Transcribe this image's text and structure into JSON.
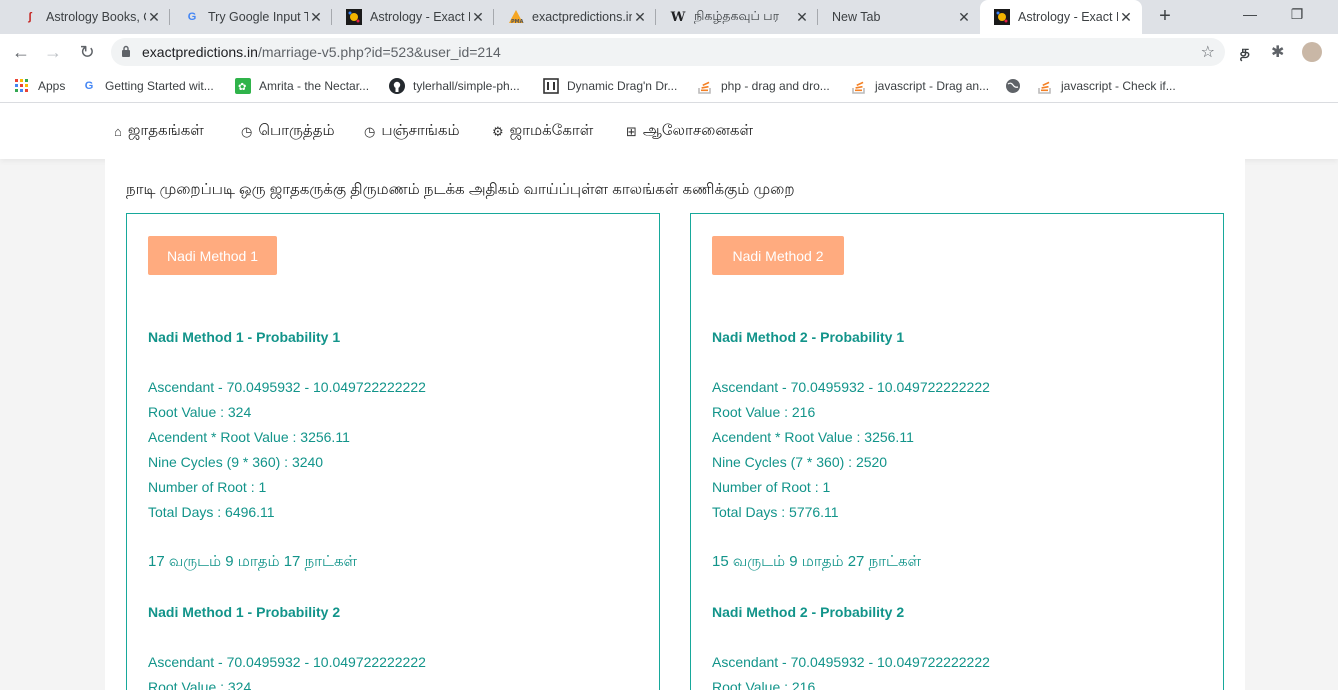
{
  "browser": {
    "tabs": [
      {
        "title": "Astrology Books, C",
        "icon": "pdf-red-icon",
        "active": false
      },
      {
        "title": "Try Google Input T",
        "icon": "google-icon",
        "active": false
      },
      {
        "title": "Astrology - Exact P",
        "icon": "astro-icon",
        "active": false
      },
      {
        "title": "exactpredictions.in",
        "icon": "pma-icon",
        "active": false
      },
      {
        "title": "நிகழ்தகவுப் பர",
        "icon": "wikipedia-icon",
        "active": false
      },
      {
        "title": "New Tab",
        "icon": "",
        "active": false
      },
      {
        "title": "Astrology - Exact P",
        "icon": "astro-icon",
        "active": true
      }
    ],
    "url_host": "exactpredictions.in",
    "url_path": "/marriage-v5.php?id=523&user_id=214",
    "profile_letter": "த",
    "bookmarks": [
      {
        "label": "Apps",
        "icon": "apps-grid-icon"
      },
      {
        "label": "Getting Started wit...",
        "icon": "google-icon"
      },
      {
        "label": "Amrita - the Nectar...",
        "icon": "amrita-icon"
      },
      {
        "label": "tylerhall/simple-ph...",
        "icon": "github-icon"
      },
      {
        "label": "Dynamic Drag'n Dr...",
        "icon": "book-icon"
      },
      {
        "label": "php - drag and dro...",
        "icon": "stackoverflow-icon"
      },
      {
        "label": "javascript - Drag an...",
        "icon": "stackoverflow-icon"
      },
      {
        "label": "",
        "icon": "globe-icon"
      },
      {
        "label": "javascript - Check if...",
        "icon": "stackoverflow-icon"
      }
    ]
  },
  "site_nav": [
    {
      "label": "ஜாதகங்கள்",
      "icon": "home-icon"
    },
    {
      "label": "பொருத்தம்",
      "icon": "clock-icon"
    },
    {
      "label": "பஞ்சாங்கம்",
      "icon": "clock-icon"
    },
    {
      "label": "ஜாமக்கோள்",
      "icon": "gear-icon"
    },
    {
      "label": "ஆலோசனைகள்",
      "icon": "grid-icon"
    }
  ],
  "intro_text": "நாடி முறைப்படி ஒரு ஜாதகருக்கு திருமணம் நடக்க அதிகம் வாய்ப்புள்ள காலங்கள் கணிக்கும் முறை",
  "methods": [
    {
      "button": "Nadi Method 1",
      "p1_title": "Nadi Method 1 - Probability 1",
      "ascendant": "Ascendant - 70.0495932 - 10.049722222222",
      "root_value": "Root Value : 324",
      "asc_root": "Acendent * Root Value : 3256.11",
      "cycles": "Nine Cycles (9 * 360) : 3240",
      "num_root": "Number of Root : 1",
      "total_days": "Total Days : 6496.11",
      "duration": "17 வருடம் 9 மாதம் 17 நாட்கள்",
      "p2_title": "Nadi Method 1 - Probability 2",
      "p2_ascendant": "Ascendant - 70.0495932 - 10.049722222222",
      "p2_root_value": "Root Value : 324"
    },
    {
      "button": "Nadi Method 2",
      "p1_title": "Nadi Method 2 - Probability 1",
      "ascendant": "Ascendant - 70.0495932 - 10.049722222222",
      "root_value": "Root Value : 216",
      "asc_root": "Acendent * Root Value : 3256.11",
      "cycles": "Nine Cycles (7 * 360) : 2520",
      "num_root": "Number of Root : 1",
      "total_days": "Total Days : 5776.11",
      "duration": "15 வருடம் 9 மாதம் 27 நாட்கள்",
      "p2_title": "Nadi Method 2 - Probability 2",
      "p2_ascendant": "Ascendant - 70.0495932 - 10.049722222222",
      "p2_root_value": "Root Value : 216"
    }
  ]
}
